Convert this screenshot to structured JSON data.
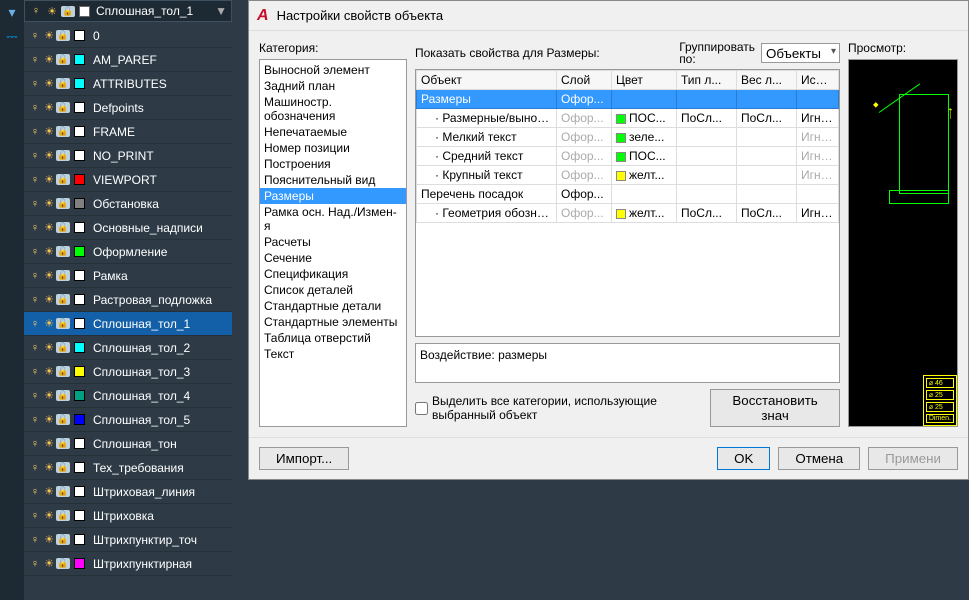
{
  "top_combo": {
    "name": "Сплошная_тол_1"
  },
  "layers": [
    {
      "name": "0",
      "color": "#ffffff"
    },
    {
      "name": "AM_PAREF",
      "color": "#00ffff"
    },
    {
      "name": "ATTRIBUTES",
      "color": "#00ffff"
    },
    {
      "name": "Defpoints",
      "color": "#ffffff"
    },
    {
      "name": "FRAME",
      "color": "#ffffff"
    },
    {
      "name": "NO_PRINT",
      "color": "#ffffff"
    },
    {
      "name": "VIEWPORT",
      "color": "#ff0000"
    },
    {
      "name": "Обстановка",
      "color": "#808080"
    },
    {
      "name": "Основные_надписи",
      "color": "#ffffff"
    },
    {
      "name": "Оформление",
      "color": "#00ff00"
    },
    {
      "name": "Рамка",
      "color": "#ffffff"
    },
    {
      "name": "Растровая_подложка",
      "color": "#ffffff"
    },
    {
      "name": "Сплошная_тол_1",
      "color": "#ffffff",
      "selected": true
    },
    {
      "name": "Сплошная_тол_2",
      "color": "#00ffff"
    },
    {
      "name": "Сплошная_тол_3",
      "color": "#ffff00"
    },
    {
      "name": "Сплошная_тол_4",
      "color": "#00a080"
    },
    {
      "name": "Сплошная_тол_5",
      "color": "#0000ff"
    },
    {
      "name": "Сплошная_тон",
      "color": "#ffffff"
    },
    {
      "name": "Тех_требования",
      "color": "#ffffff"
    },
    {
      "name": "Штриховая_линия",
      "color": "#ffffff"
    },
    {
      "name": "Штриховка",
      "color": "#ffffff"
    },
    {
      "name": "Штрихпунктир_точ",
      "color": "#ffffff"
    },
    {
      "name": "Штрихпунктирная",
      "color": "#ff00ff"
    }
  ],
  "dialog": {
    "title": "Настройки свойств объекта",
    "category_label": "Категория:",
    "show_label": "Показать свойства для Размеры:",
    "group_label_1": "Группировать",
    "group_label_2": "по:",
    "group_value": "Объекты",
    "preview_label": "Просмотр:",
    "impact_label": "Воздействие: размеры",
    "checkbox_label": "Выделить все категории, использующие выбранный объект",
    "restore_btn": "Восстановить знач",
    "import_btn": "Импорт...",
    "ok_btn": "OK",
    "cancel_btn": "Отмена",
    "apply_btn": "Примени"
  },
  "categories": [
    "Выносной элемент",
    "Задний план",
    "Машиностр. обозначения",
    "Непечатаемые",
    "Номер позиции",
    "Построения",
    "Пояснительный вид",
    "Размеры",
    "Рамка осн. Над./Измен-я",
    "Расчеты",
    "Сечение",
    "Спецификация",
    "Список деталей",
    "Стандартные детали",
    "Стандартные элементы",
    "Таблица отверстий",
    "Текст"
  ],
  "cat_selected": 7,
  "grid": {
    "headers": [
      "Объект",
      "Слой",
      "Цвет",
      "Тип л...",
      "Вес л...",
      "Использ..."
    ],
    "rows": [
      {
        "obj": "Размеры",
        "layer": "Офор...",
        "hl": true
      },
      {
        "obj": "Размерные/выносн...",
        "layer": "Офор...",
        "color": "#00ff00",
        "clabel": "ПОС...",
        "lt": "ПоСл...",
        "lw": "ПоСл...",
        "use": "Игнор. н...",
        "indent": true,
        "disLayer": true
      },
      {
        "obj": "Мелкий текст",
        "layer": "Офор...",
        "color": "#00ff00",
        "clabel": "зеле...",
        "use": "Игнор. н...",
        "indent": true,
        "disLayer": true,
        "disUse": true
      },
      {
        "obj": "Средний текст",
        "layer": "Офор...",
        "color": "#00ff00",
        "clabel": "ПОС...",
        "use": "Игнор. н...",
        "indent": true,
        "disLayer": true,
        "disUse": true
      },
      {
        "obj": "Крупный текст",
        "layer": "Офор...",
        "color": "#ffff00",
        "clabel": "желт...",
        "use": "Игнор. н...",
        "indent": true,
        "disLayer": true,
        "disUse": true
      },
      {
        "obj": "Перечень посадок",
        "layer": "Офор..."
      },
      {
        "obj": "Геометрия обозначе...",
        "layer": "Офор...",
        "color": "#ffff00",
        "clabel": "желт...",
        "lt": "ПоСл...",
        "lw": "ПоСл...",
        "use": "Игнор. н...",
        "indent": true,
        "disLayer": true
      }
    ]
  },
  "preview_dims": [
    "⌀ 46",
    "⌀ 25",
    "⌀ 25",
    "Dimen."
  ]
}
